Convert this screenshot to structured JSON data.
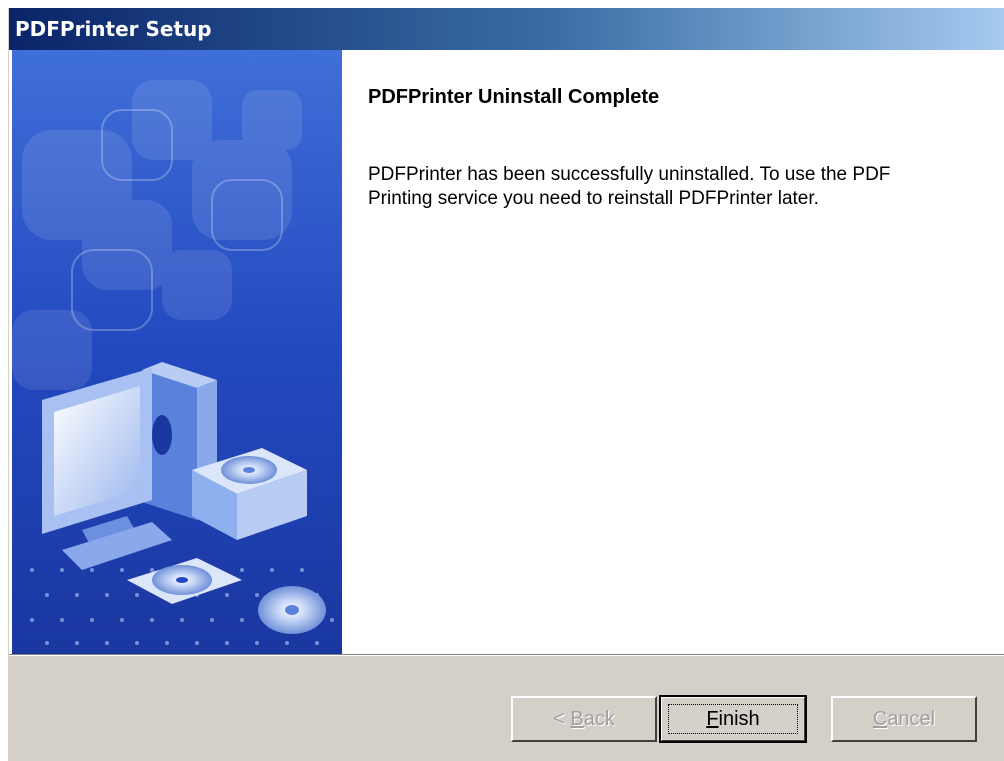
{
  "window": {
    "title": "PDFPrinter Setup"
  },
  "main": {
    "heading": "PDFPrinter Uninstall Complete",
    "message_line1": "PDFPrinter has been successfully uninstalled.  To use the PDF",
    "message_line2": "Printing service you need to reinstall PDFPrinter later."
  },
  "buttons": {
    "back": {
      "prefix": "< ",
      "mnemonic": "B",
      "rest": "ack",
      "enabled": false
    },
    "finish": {
      "prefix": "",
      "mnemonic": "F",
      "rest": "inish",
      "enabled": true
    },
    "cancel": {
      "prefix": "",
      "mnemonic": "C",
      "rest": "ancel",
      "enabled": false
    }
  },
  "colors": {
    "titlebar_start": "#0a246a",
    "titlebar_end": "#a6caf0",
    "banner_blue": "#1e3fb0",
    "dialog_face": "#d4d0c8"
  }
}
